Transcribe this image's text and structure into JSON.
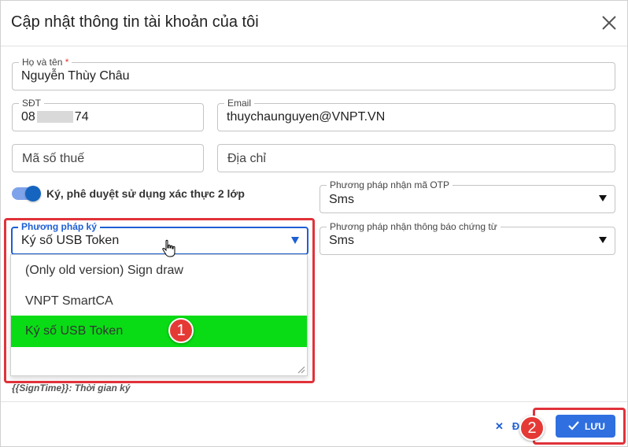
{
  "dialog": {
    "title": "Cập nhật thông tin tài khoản của tôi",
    "close_icon": "close-icon"
  },
  "form": {
    "fullname": {
      "label": "Họ và tên",
      "required_mark": "*",
      "value": "Nguyễn Thùy Châu"
    },
    "phone": {
      "label": "SĐT",
      "value_start": "08",
      "value_end": "74"
    },
    "email": {
      "label": "Email",
      "value": "thuychaunguyen@VNPT.VN"
    },
    "tax_code": {
      "placeholder": "Mã số thuế"
    },
    "address": {
      "placeholder": "Địa chỉ"
    },
    "two_factor": {
      "label": "Ký, phê duyệt sử dụng xác thực 2 lớp",
      "enabled": true
    },
    "otp_method": {
      "label": "Phương pháp nhận mã OTP",
      "value": "Sms"
    },
    "sign_method": {
      "label": "Phương pháp ký",
      "value": "Ký số USB Token"
    },
    "notify_method": {
      "label": "Phương pháp nhận thông báo chứng từ",
      "value": "Sms"
    },
    "hint": "{{SignTime}}: Thời gian ký"
  },
  "dropdown": {
    "options": [
      "(Only old version) Sign draw",
      "VNPT SmartCA",
      "Ký số USB Token"
    ],
    "selected_index": 2
  },
  "annotations": {
    "step1": "1",
    "step2": "2",
    "color": "#e53935"
  },
  "footer": {
    "cancel_label": "Đ",
    "save_label": "LƯU"
  },
  "colors": {
    "primary": "#2f6fe0",
    "selected_option": "#09dc15",
    "highlight": "#e0323a"
  }
}
